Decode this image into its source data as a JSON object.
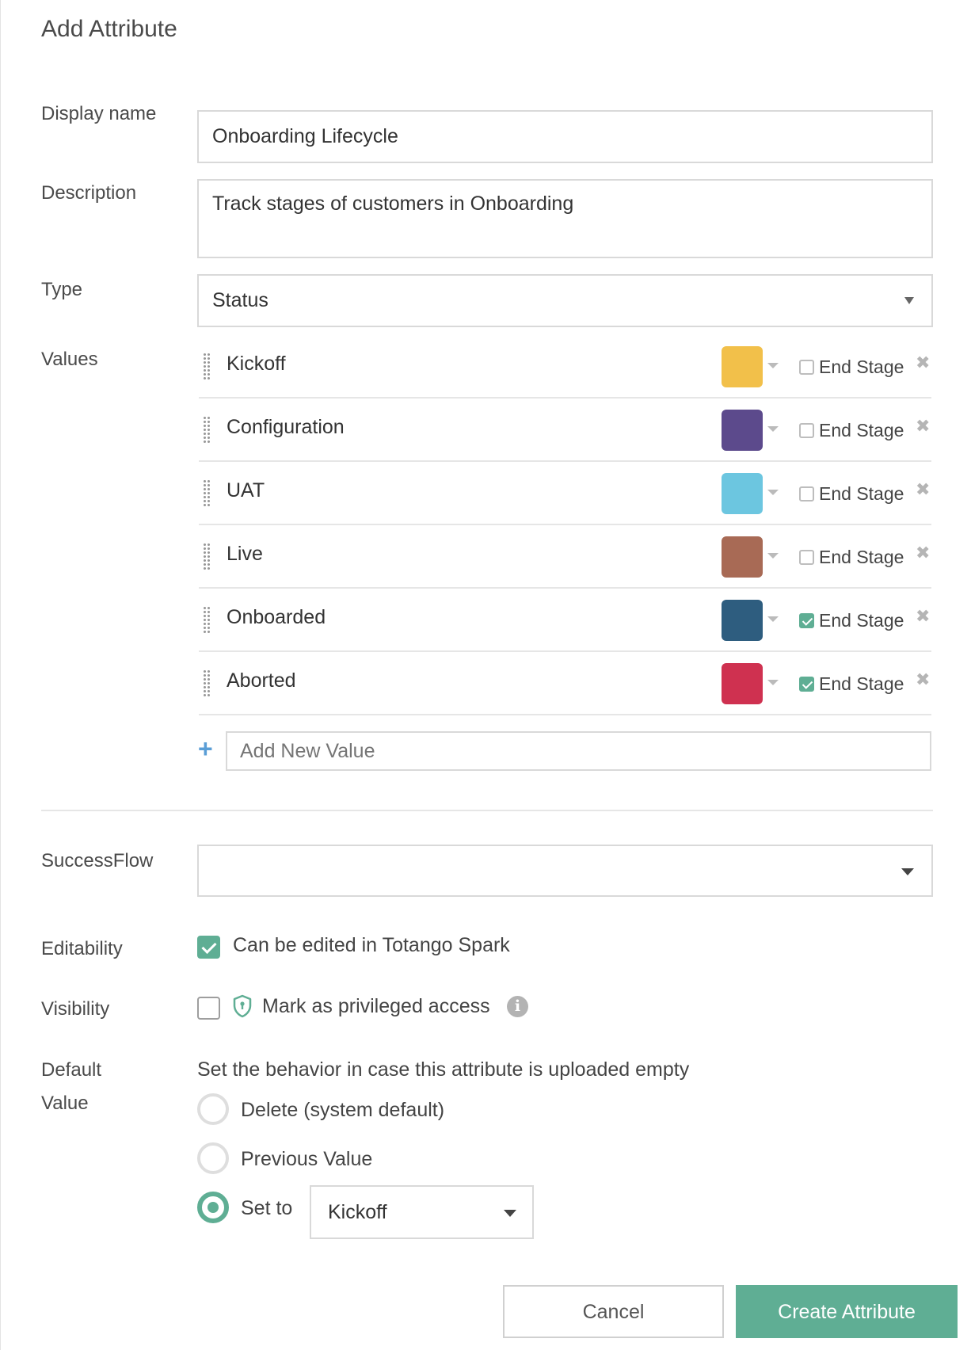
{
  "dialog": {
    "title": "Add Attribute"
  },
  "labels": {
    "display_name": "Display name",
    "description": "Description",
    "type": "Type",
    "values": "Values",
    "successflow": "SuccessFlow",
    "editability": "Editability",
    "visibility": "Visibility",
    "default_value_line1": "Default",
    "default_value_line2": "Value"
  },
  "fields": {
    "display_name": "Onboarding Lifecycle",
    "description": "Track stages of customers in Onboarding",
    "type": "Status",
    "successflow": ""
  },
  "values": [
    {
      "name": "Kickoff",
      "color": "#f2c04a",
      "end_stage": false,
      "end_label": "End Stage"
    },
    {
      "name": "Configuration",
      "color": "#5c4a8c",
      "end_stage": false,
      "end_label": "End Stage"
    },
    {
      "name": "UAT",
      "color": "#6cc6e0",
      "end_stage": false,
      "end_label": "End Stage"
    },
    {
      "name": "Live",
      "color": "#a86a55",
      "end_stage": false,
      "end_label": "End Stage"
    },
    {
      "name": "Onboarded",
      "color": "#2e5d7f",
      "end_stage": true,
      "end_label": "End Stage"
    },
    {
      "name": "Aborted",
      "color": "#cf3150",
      "end_stage": true,
      "end_label": "End Stage"
    }
  ],
  "add_value": {
    "placeholder": "Add New Value",
    "icon": "plus-icon"
  },
  "editability": {
    "checked": true,
    "label": "Can be edited in Totango Spark"
  },
  "visibility": {
    "checked": false,
    "label": "Mark as privileged access",
    "icon": "shield-icon",
    "info_icon": "info-icon",
    "info_glyph": "i"
  },
  "default_value": {
    "hint": "Set the behavior in case this attribute is uploaded empty",
    "options": [
      {
        "label": "Delete (system default)",
        "selected": false
      },
      {
        "label": "Previous Value",
        "selected": false
      },
      {
        "label": "Set to",
        "selected": true
      }
    ],
    "set_to_value": "Kickoff"
  },
  "buttons": {
    "cancel": "Cancel",
    "create": "Create Attribute"
  },
  "colors": {
    "accent": "#5fae94",
    "plus": "#5a9ed6",
    "border": "#d9d9d9"
  }
}
